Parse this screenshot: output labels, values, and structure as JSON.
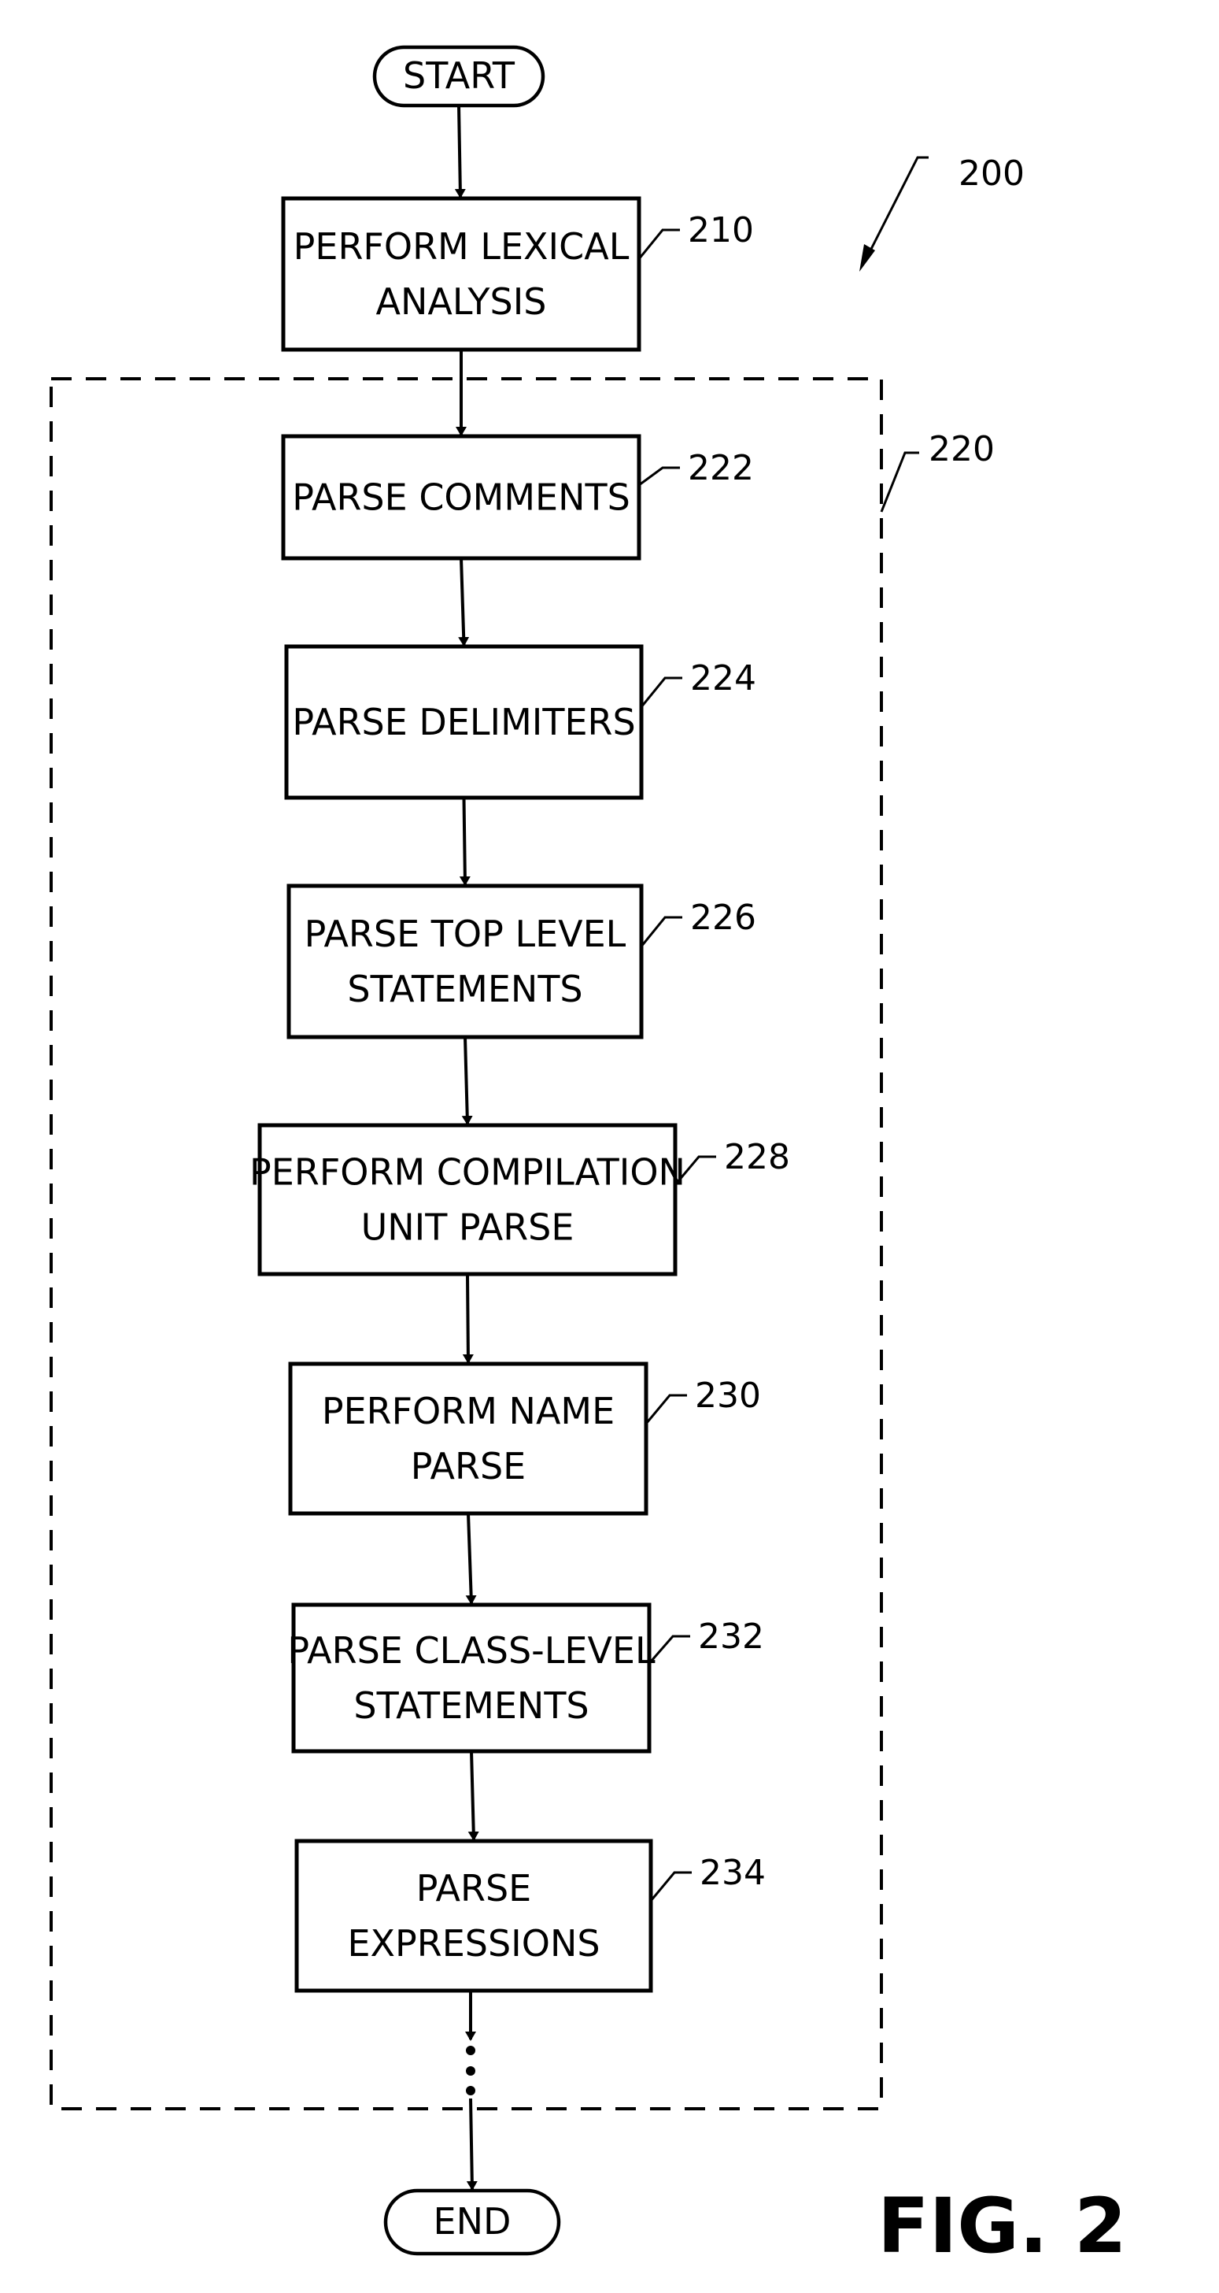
{
  "figure": {
    "title": "FIG. 2",
    "ref": "200",
    "group": {
      "ref": "220"
    },
    "start": {
      "label": "START"
    },
    "end": {
      "label": "END"
    },
    "steps": [
      {
        "ref": "210",
        "lines": [
          "PERFORM LEXICAL",
          "ANALYSIS"
        ]
      },
      {
        "ref": "222",
        "lines": [
          "PARSE COMMENTS"
        ]
      },
      {
        "ref": "224",
        "lines": [
          "PARSE DELIMITERS"
        ]
      },
      {
        "ref": "226",
        "lines": [
          "PARSE TOP LEVEL",
          "STATEMENTS"
        ]
      },
      {
        "ref": "228",
        "lines": [
          "PERFORM COMPILATION",
          "UNIT PARSE"
        ]
      },
      {
        "ref": "230",
        "lines": [
          "PERFORM NAME",
          "PARSE"
        ]
      },
      {
        "ref": "232",
        "lines": [
          "PARSE CLASS-LEVEL",
          "STATEMENTS"
        ]
      },
      {
        "ref": "234",
        "lines": [
          "PARSE",
          "EXPRESSIONS"
        ]
      }
    ],
    "continuation": "⋮"
  }
}
